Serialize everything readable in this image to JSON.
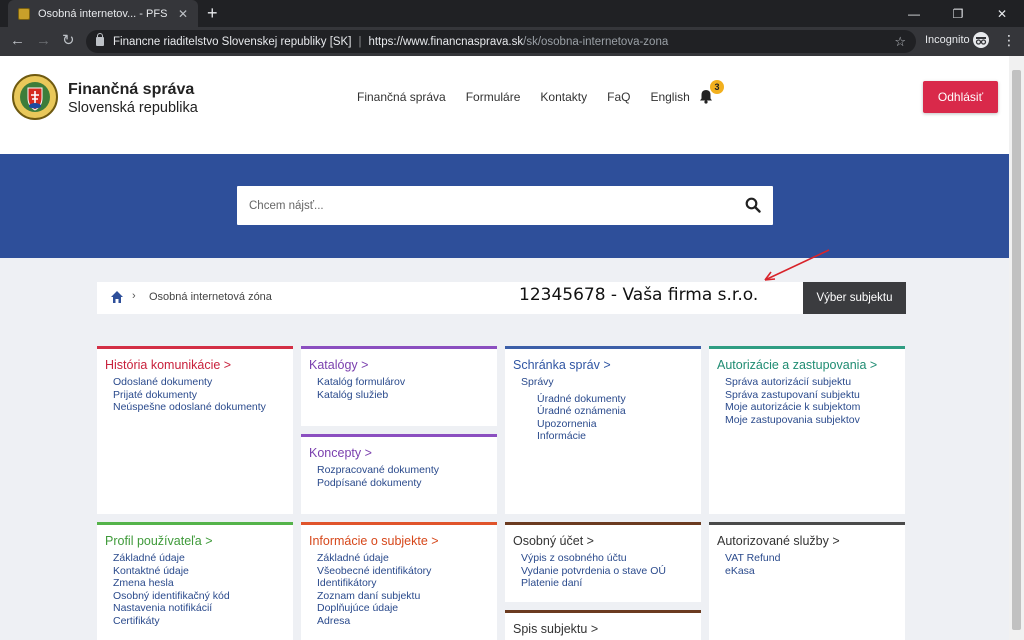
{
  "browser": {
    "tab_title": "Osobná internetov... - PFS",
    "tab_close": "✕",
    "new_tab": "+",
    "site_identity": "Financne riaditelstvo Slovenskej republiky [SK]",
    "url_host": "https://www.financnasprava.sk",
    "url_path": "/sk/osobna-internetova-zona",
    "incognito_label": "Incognito",
    "win_min": "—",
    "win_restore": "❐",
    "win_close": "✕",
    "back": "←",
    "forward": "→",
    "reload": "↻",
    "star": "☆",
    "menu": "⋮"
  },
  "header": {
    "brand_line1": "Finančná správa",
    "brand_line2": "Slovenská republika",
    "nav": [
      "Finančná správa",
      "Formuláre",
      "Kontakty",
      "FaQ",
      "English"
    ],
    "notification_count": "3",
    "logout_label": "Odhlásiť"
  },
  "search": {
    "placeholder": "Chcem nájsť..."
  },
  "breadcrumb": {
    "current": "Osobná internetová zóna",
    "separator": "›"
  },
  "subject": {
    "company": "12345678 - Vaša firma s.r.o.",
    "select_button": "Výber subjektu"
  },
  "cards": {
    "historia": {
      "title": "História komunikácie >",
      "items": [
        "Odoslané dokumenty",
        "Prijaté dokumenty",
        "Neúspešne odoslané dokumenty"
      ]
    },
    "katalogy": {
      "title": "Katalógy >",
      "items": [
        "Katalóg formulárov",
        "Katalóg služieb"
      ]
    },
    "koncepty": {
      "title": "Koncepty >",
      "items": [
        "Rozpracované dokumenty",
        "Podpísané dokumenty"
      ]
    },
    "schranka": {
      "title": "Schránka správ >",
      "items": [
        "Správy"
      ],
      "subitems": [
        "Úradné dokumenty",
        "Úradné oznámenia",
        "Upozornenia",
        "Informácie"
      ]
    },
    "autorizacie": {
      "title": "Autorizácie a zastupovania >",
      "items": [
        "Správa autorizácií subjektu",
        "Správa zastupovaní subjektu",
        "Moje autorizácie k subjektom",
        "Moje zastupovania subjektov"
      ]
    },
    "profil": {
      "title": "Profil používateľa >",
      "items": [
        "Základné údaje",
        "Kontaktné údaje",
        "Zmena hesla",
        "Osobný identifikačný kód",
        "Nastavenia notifikácií",
        "Certifikáty"
      ]
    },
    "informacie": {
      "title": "Informácie o subjekte >",
      "items": [
        "Základné údaje",
        "Všeobecné identifikátory",
        "Identifikátory",
        "Zoznam daní subjektu",
        "Doplňujúce údaje",
        "Adresa"
      ]
    },
    "ucet": {
      "title": "Osobný účet >",
      "items": [
        "Výpis z osobného účtu",
        "Vydanie potvrdenia o stave OÚ",
        "Platenie daní"
      ]
    },
    "spis": {
      "title": "Spis subjektu >"
    },
    "sluzby": {
      "title": "Autorizované služby >",
      "items": [
        "VAT Refund",
        "eKasa"
      ]
    }
  },
  "colors": {
    "hero": "#2e4f9a",
    "logout": "#d9294a",
    "badge": "#f2b01e"
  }
}
